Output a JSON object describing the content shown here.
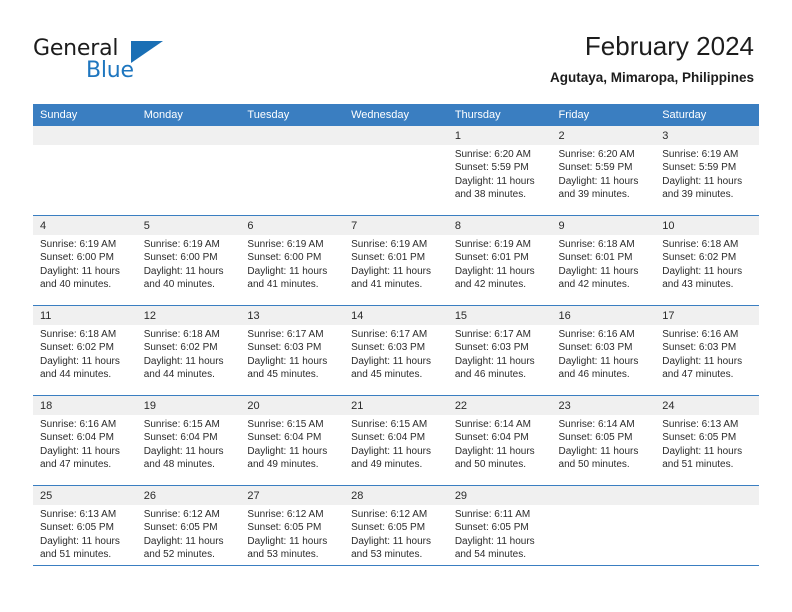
{
  "brand": {
    "name_part1": "General",
    "name_part2": "Blue",
    "logo_icon": "triangle-logo-icon",
    "accent_color": "#1a6fb5"
  },
  "header": {
    "title": "February 2024",
    "location": "Agutaya, Mimaropa, Philippines"
  },
  "theme": {
    "header_blue": "#3a7ec1",
    "daynum_band": "#f0f0f0",
    "text": "#2b2b2b"
  },
  "weekday_headers": [
    "Sunday",
    "Monday",
    "Tuesday",
    "Wednesday",
    "Thursday",
    "Friday",
    "Saturday"
  ],
  "weeks": [
    [
      {
        "day": "",
        "empty": true,
        "sunrise": "",
        "sunset": "",
        "daylight1": "",
        "daylight2": ""
      },
      {
        "day": "",
        "empty": true,
        "sunrise": "",
        "sunset": "",
        "daylight1": "",
        "daylight2": ""
      },
      {
        "day": "",
        "empty": true,
        "sunrise": "",
        "sunset": "",
        "daylight1": "",
        "daylight2": ""
      },
      {
        "day": "",
        "empty": true,
        "sunrise": "",
        "sunset": "",
        "daylight1": "",
        "daylight2": ""
      },
      {
        "day": "1",
        "sunrise": "Sunrise: 6:20 AM",
        "sunset": "Sunset: 5:59 PM",
        "daylight1": "Daylight: 11 hours",
        "daylight2": "and 38 minutes."
      },
      {
        "day": "2",
        "sunrise": "Sunrise: 6:20 AM",
        "sunset": "Sunset: 5:59 PM",
        "daylight1": "Daylight: 11 hours",
        "daylight2": "and 39 minutes."
      },
      {
        "day": "3",
        "sunrise": "Sunrise: 6:19 AM",
        "sunset": "Sunset: 5:59 PM",
        "daylight1": "Daylight: 11 hours",
        "daylight2": "and 39 minutes."
      }
    ],
    [
      {
        "day": "4",
        "sunrise": "Sunrise: 6:19 AM",
        "sunset": "Sunset: 6:00 PM",
        "daylight1": "Daylight: 11 hours",
        "daylight2": "and 40 minutes."
      },
      {
        "day": "5",
        "sunrise": "Sunrise: 6:19 AM",
        "sunset": "Sunset: 6:00 PM",
        "daylight1": "Daylight: 11 hours",
        "daylight2": "and 40 minutes."
      },
      {
        "day": "6",
        "sunrise": "Sunrise: 6:19 AM",
        "sunset": "Sunset: 6:00 PM",
        "daylight1": "Daylight: 11 hours",
        "daylight2": "and 41 minutes."
      },
      {
        "day": "7",
        "sunrise": "Sunrise: 6:19 AM",
        "sunset": "Sunset: 6:01 PM",
        "daylight1": "Daylight: 11 hours",
        "daylight2": "and 41 minutes."
      },
      {
        "day": "8",
        "sunrise": "Sunrise: 6:19 AM",
        "sunset": "Sunset: 6:01 PM",
        "daylight1": "Daylight: 11 hours",
        "daylight2": "and 42 minutes."
      },
      {
        "day": "9",
        "sunrise": "Sunrise: 6:18 AM",
        "sunset": "Sunset: 6:01 PM",
        "daylight1": "Daylight: 11 hours",
        "daylight2": "and 42 minutes."
      },
      {
        "day": "10",
        "sunrise": "Sunrise: 6:18 AM",
        "sunset": "Sunset: 6:02 PM",
        "daylight1": "Daylight: 11 hours",
        "daylight2": "and 43 minutes."
      }
    ],
    [
      {
        "day": "11",
        "sunrise": "Sunrise: 6:18 AM",
        "sunset": "Sunset: 6:02 PM",
        "daylight1": "Daylight: 11 hours",
        "daylight2": "and 44 minutes."
      },
      {
        "day": "12",
        "sunrise": "Sunrise: 6:18 AM",
        "sunset": "Sunset: 6:02 PM",
        "daylight1": "Daylight: 11 hours",
        "daylight2": "and 44 minutes."
      },
      {
        "day": "13",
        "sunrise": "Sunrise: 6:17 AM",
        "sunset": "Sunset: 6:03 PM",
        "daylight1": "Daylight: 11 hours",
        "daylight2": "and 45 minutes."
      },
      {
        "day": "14",
        "sunrise": "Sunrise: 6:17 AM",
        "sunset": "Sunset: 6:03 PM",
        "daylight1": "Daylight: 11 hours",
        "daylight2": "and 45 minutes."
      },
      {
        "day": "15",
        "sunrise": "Sunrise: 6:17 AM",
        "sunset": "Sunset: 6:03 PM",
        "daylight1": "Daylight: 11 hours",
        "daylight2": "and 46 minutes."
      },
      {
        "day": "16",
        "sunrise": "Sunrise: 6:16 AM",
        "sunset": "Sunset: 6:03 PM",
        "daylight1": "Daylight: 11 hours",
        "daylight2": "and 46 minutes."
      },
      {
        "day": "17",
        "sunrise": "Sunrise: 6:16 AM",
        "sunset": "Sunset: 6:03 PM",
        "daylight1": "Daylight: 11 hours",
        "daylight2": "and 47 minutes."
      }
    ],
    [
      {
        "day": "18",
        "sunrise": "Sunrise: 6:16 AM",
        "sunset": "Sunset: 6:04 PM",
        "daylight1": "Daylight: 11 hours",
        "daylight2": "and 47 minutes."
      },
      {
        "day": "19",
        "sunrise": "Sunrise: 6:15 AM",
        "sunset": "Sunset: 6:04 PM",
        "daylight1": "Daylight: 11 hours",
        "daylight2": "and 48 minutes."
      },
      {
        "day": "20",
        "sunrise": "Sunrise: 6:15 AM",
        "sunset": "Sunset: 6:04 PM",
        "daylight1": "Daylight: 11 hours",
        "daylight2": "and 49 minutes."
      },
      {
        "day": "21",
        "sunrise": "Sunrise: 6:15 AM",
        "sunset": "Sunset: 6:04 PM",
        "daylight1": "Daylight: 11 hours",
        "daylight2": "and 49 minutes."
      },
      {
        "day": "22",
        "sunrise": "Sunrise: 6:14 AM",
        "sunset": "Sunset: 6:04 PM",
        "daylight1": "Daylight: 11 hours",
        "daylight2": "and 50 minutes."
      },
      {
        "day": "23",
        "sunrise": "Sunrise: 6:14 AM",
        "sunset": "Sunset: 6:05 PM",
        "daylight1": "Daylight: 11 hours",
        "daylight2": "and 50 minutes."
      },
      {
        "day": "24",
        "sunrise": "Sunrise: 6:13 AM",
        "sunset": "Sunset: 6:05 PM",
        "daylight1": "Daylight: 11 hours",
        "daylight2": "and 51 minutes."
      }
    ],
    [
      {
        "day": "25",
        "sunrise": "Sunrise: 6:13 AM",
        "sunset": "Sunset: 6:05 PM",
        "daylight1": "Daylight: 11 hours",
        "daylight2": "and 51 minutes."
      },
      {
        "day": "26",
        "sunrise": "Sunrise: 6:12 AM",
        "sunset": "Sunset: 6:05 PM",
        "daylight1": "Daylight: 11 hours",
        "daylight2": "and 52 minutes."
      },
      {
        "day": "27",
        "sunrise": "Sunrise: 6:12 AM",
        "sunset": "Sunset: 6:05 PM",
        "daylight1": "Daylight: 11 hours",
        "daylight2": "and 53 minutes."
      },
      {
        "day": "28",
        "sunrise": "Sunrise: 6:12 AM",
        "sunset": "Sunset: 6:05 PM",
        "daylight1": "Daylight: 11 hours",
        "daylight2": "and 53 minutes."
      },
      {
        "day": "29",
        "sunrise": "Sunrise: 6:11 AM",
        "sunset": "Sunset: 6:05 PM",
        "daylight1": "Daylight: 11 hours",
        "daylight2": "and 54 minutes."
      },
      {
        "day": "",
        "empty": true,
        "sunrise": "",
        "sunset": "",
        "daylight1": "",
        "daylight2": ""
      },
      {
        "day": "",
        "empty": true,
        "sunrise": "",
        "sunset": "",
        "daylight1": "",
        "daylight2": ""
      }
    ]
  ]
}
